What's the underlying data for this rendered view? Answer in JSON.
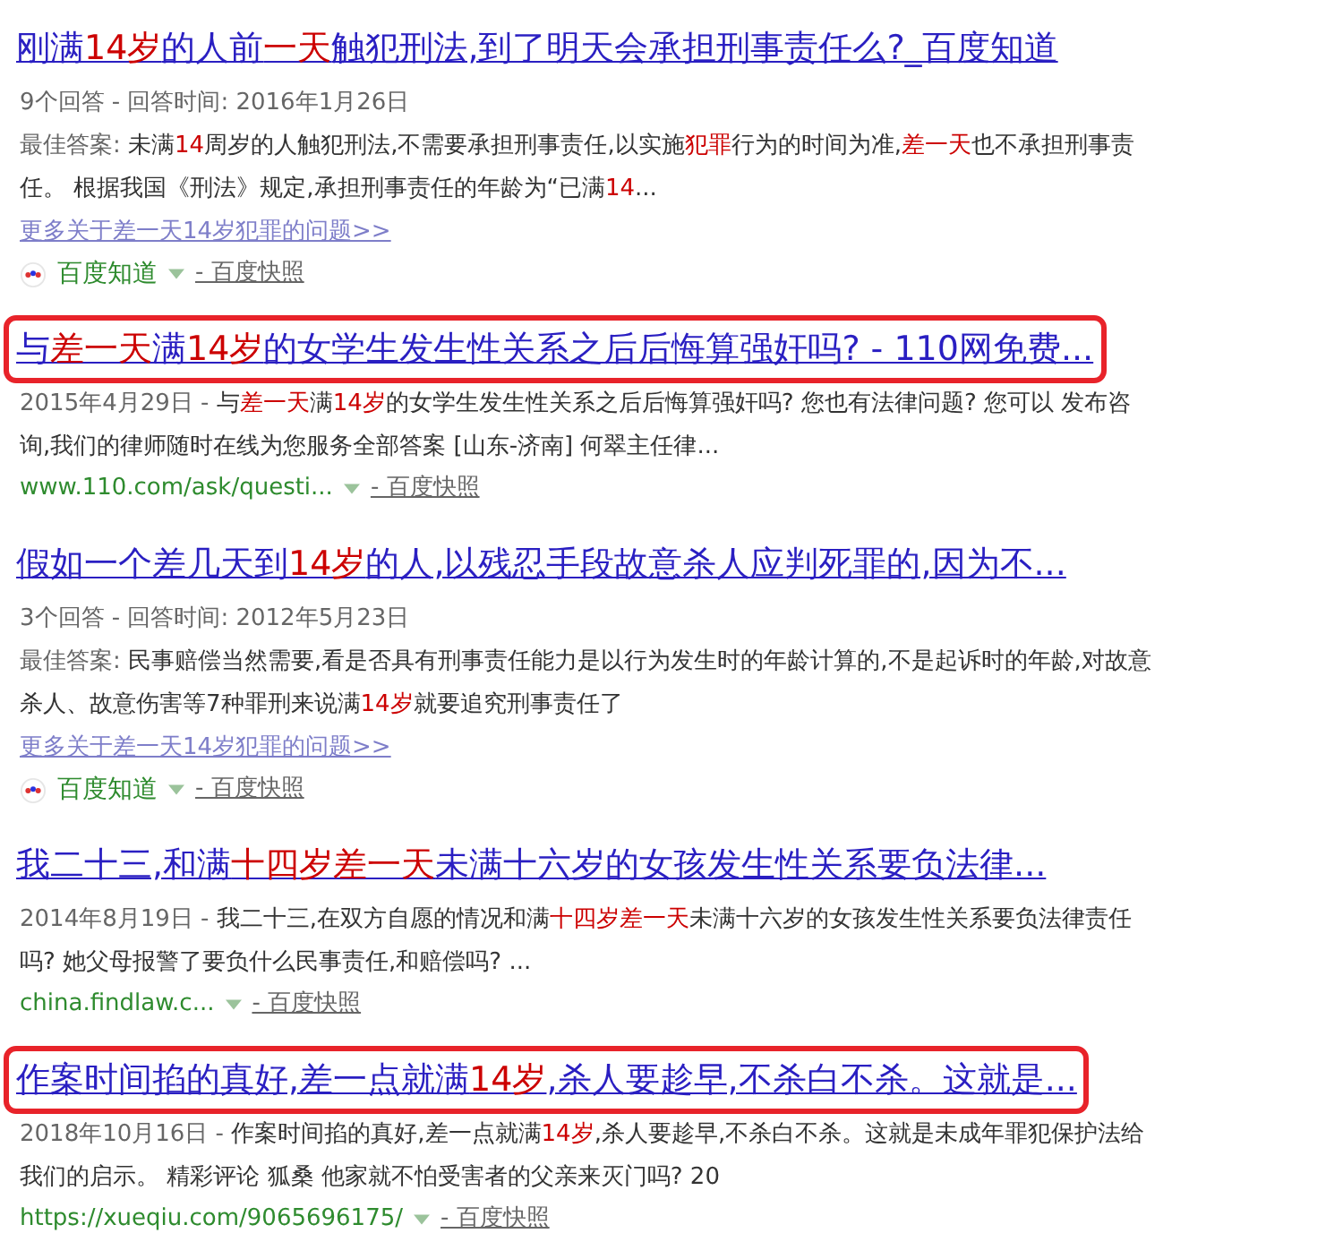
{
  "results": [
    {
      "title": "刚满**14岁**的人前**一天**触犯刑法,到了明天会承担刑事责任么?_百度知道",
      "highlighted": false,
      "meta": "9个回答 - 回答时间: 2016年1月26日",
      "snippet_label": "最佳答案:",
      "snippet": "未满**14**周岁的人触犯刑法,不需要承担刑事责任,以实施**犯罪**行为的时间为准,**差一天**也不承担刑事责任。 根据我国《刑法》规定,承担刑事责任的年龄为“已满**14**...",
      "more_link": "更多关于差一天14岁犯罪的问题>>",
      "source": {
        "kind": "site",
        "name": "百度知道"
      },
      "snapshot": "- 百度快照"
    },
    {
      "title": "与**差一天**满**14岁**的女学生发生性关系之后后悔算强奸吗? - 110网免费...",
      "highlighted": true,
      "snippet_label": "2015年4月29日 -",
      "snippet": "与**差一天**满**14岁**的女学生发生性关系之后后悔算强奸吗? 您也有法律问题? 您可以 发布咨询,我们的律师随时在线为您服务全部答案 [山东-济南] 何翠主任律...",
      "source": {
        "kind": "url",
        "name": "www.110.com/ask/questi..."
      },
      "snapshot": "- 百度快照"
    },
    {
      "title": "假如一个差几天到**14岁**的人,以残忍手段故意杀人应判死罪的,因为不...",
      "highlighted": false,
      "meta": "3个回答 - 回答时间: 2012年5月23日",
      "snippet_label": "最佳答案:",
      "snippet": "民事赔偿当然需要,看是否具有刑事责任能力是以行为发生时的年龄计算的,不是起诉时的年龄,对故意杀人、故意伤害等7种罪刑来说满**14岁**就要追究刑事责任了",
      "more_link": "更多关于差一天14岁犯罪的问题>>",
      "source": {
        "kind": "site",
        "name": "百度知道"
      },
      "snapshot": "- 百度快照"
    },
    {
      "title": "我二十三,和满**十四岁差一天**未满十六岁的女孩发生性关系要负法律...",
      "highlighted": false,
      "snippet_label": "2014年8月19日 -",
      "snippet": "我二十三,在双方自愿的情况和满**十四岁差一天**未满十六岁的女孩发生性关系要负法律责任吗? 她父母报警了要负什么民事责任,和赔偿吗? ...",
      "source": {
        "kind": "url",
        "name": "china.findlaw.c..."
      },
      "snapshot": "- 百度快照"
    },
    {
      "title": "作案时间掐的真好,差一点就满**14岁**,杀人要趁早,不杀白不杀。这就是...",
      "highlighted": true,
      "snippet_label": "2018年10月16日 -",
      "snippet": "作案时间掐的真好,差一点就满**14岁**,杀人要趁早,不杀白不杀。这就是未成年罪犯保护法给我们的启示。 精彩评论 狐桑 他家就不怕受害者的父亲来灭门吗? 20",
      "source": {
        "kind": "url",
        "name": "https://xueqiu.com/9065696175/"
      },
      "snapshot": "- 百度快照"
    }
  ]
}
